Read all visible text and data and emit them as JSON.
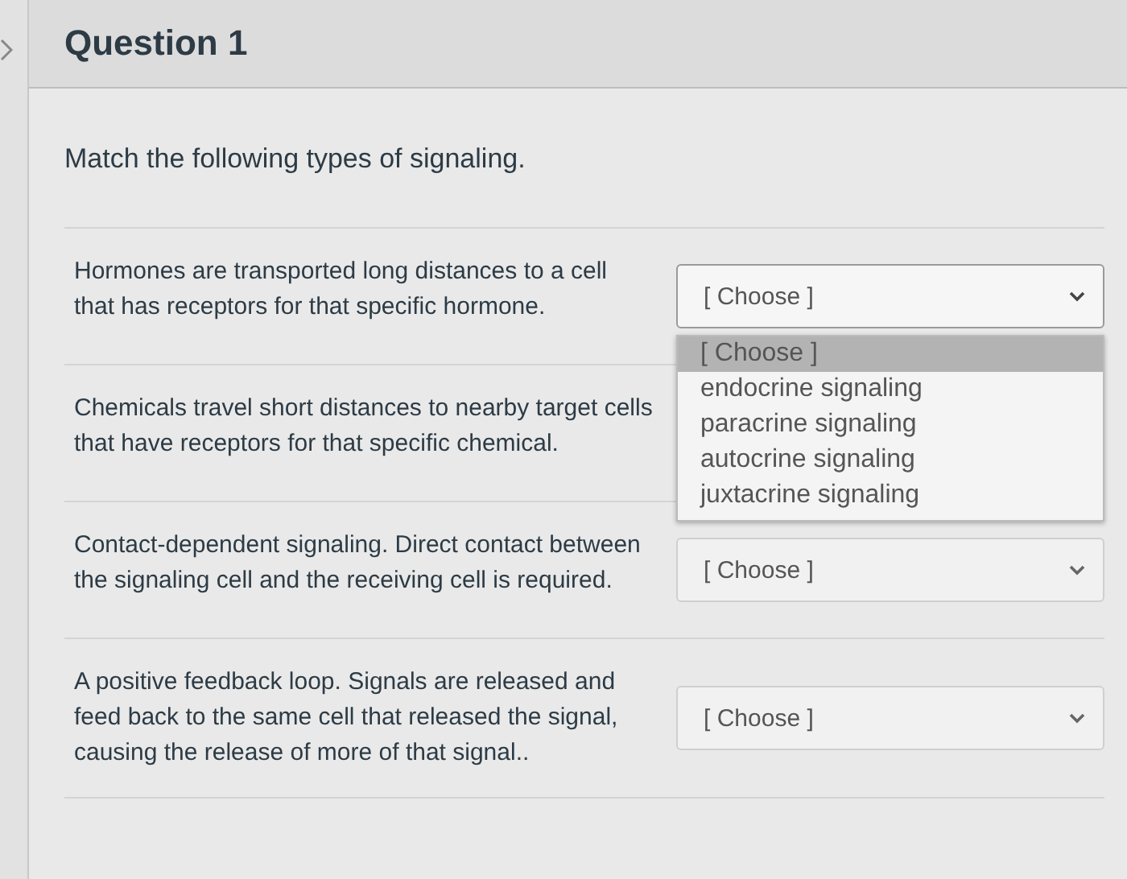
{
  "question": {
    "title": "Question 1",
    "prompt": "Match the following types of signaling."
  },
  "rows": [
    {
      "statement": "Hormones are transported long distances to a cell that has receptors for that specific hormone.",
      "answer": {
        "value": "[ Choose ]",
        "expanded": true,
        "options": [
          {
            "label": "[ Choose ]",
            "selected": true
          },
          {
            "label": "endocrine signaling",
            "selected": false
          },
          {
            "label": "paracrine signaling",
            "selected": false
          },
          {
            "label": "autocrine signaling",
            "selected": false
          },
          {
            "label": "juxtacrine signaling",
            "selected": false
          }
        ]
      }
    },
    {
      "statement": "Chemicals travel short distances to nearby target cells that have receptors for that specific chemical."
    },
    {
      "statement": "Contact-dependent signaling. Direct contact between the signaling cell and the receiving cell is required.",
      "answer": {
        "value": "[ Choose ]",
        "expanded": false
      }
    },
    {
      "statement": "A positive feedback loop. Signals are released and feed back to the same cell that released the signal, causing the release of more of that signal..",
      "answer": {
        "value": "[ Choose ]",
        "expanded": false
      }
    }
  ]
}
